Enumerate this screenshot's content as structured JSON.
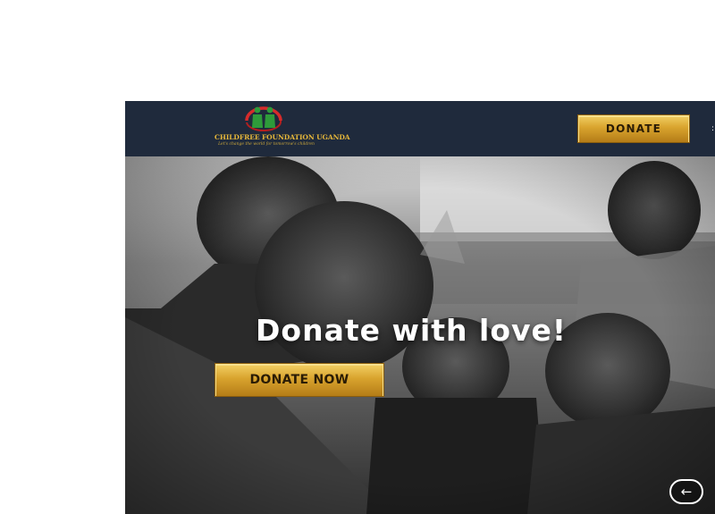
{
  "header": {
    "logo": {
      "name": "CHILDFREE FOUNDATION UGANDA",
      "tagline": "Let's change the world for tomorrow's children",
      "colors": {
        "ring": "#d72b2b",
        "figures": "#2e9b3a"
      }
    },
    "donate_label": "DONATE",
    "background": "#1f2a3c"
  },
  "hero": {
    "title": "Donate with love!",
    "donate_now_label": "DONATE NOW",
    "back_icon": "arrow-left-icon",
    "image_description_visible": false
  },
  "colors": {
    "gold_light": "#f5d46a",
    "gold_dark": "#b27a16",
    "button_text": "#2a1c05"
  }
}
